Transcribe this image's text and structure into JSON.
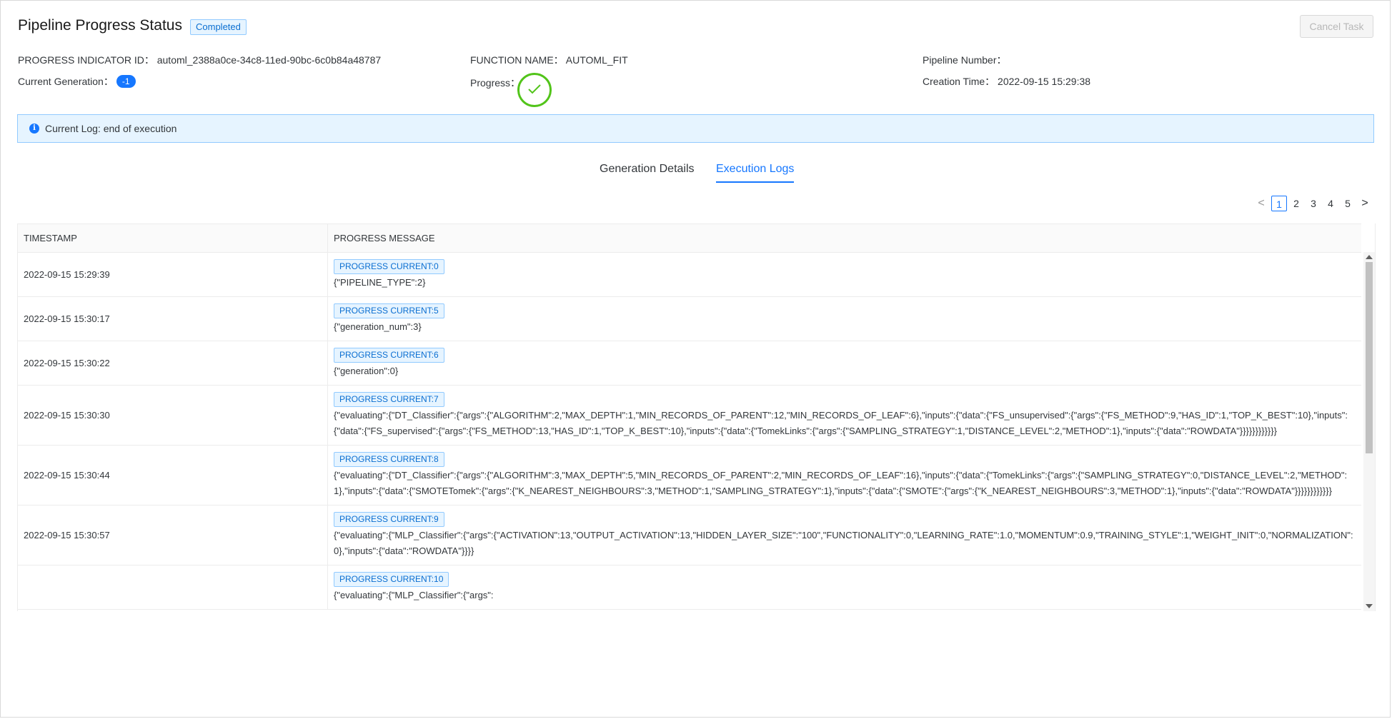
{
  "header": {
    "title": "Pipeline Progress Status",
    "status": "Completed",
    "cancel_label": "Cancel Task"
  },
  "info": {
    "progress_indicator": "PROGRESS INDICATOR ID： automl_2388a0ce-34c8-11ed-90bc-6c0b84a48787",
    "function_name": "FUNCTION NAME： AUTOML_FIT",
    "pipeline_number": "Pipeline Number：",
    "current_generation_label": "Current Generation：",
    "current_generation_value": "-1",
    "progress_label": "Progress：",
    "creation_time": "Creation Time： 2022-09-15 15:29:38"
  },
  "log": {
    "text": "Current Log: end of execution"
  },
  "tabs": [
    {
      "label": "Generation Details",
      "active": false
    },
    {
      "label": "Execution Logs",
      "active": true
    }
  ],
  "pagination": {
    "pages": [
      "1",
      "2",
      "3",
      "4",
      "5"
    ],
    "current": "1",
    "prev": "<",
    "next": ">"
  },
  "table": {
    "columns": [
      "TIMESTAMP",
      "PROGRESS MESSAGE"
    ],
    "rows": [
      {
        "timestamp": "2022-09-15 15:29:39",
        "tag": "PROGRESS CURRENT:0",
        "message": "{\"PIPELINE_TYPE\":2}"
      },
      {
        "timestamp": "2022-09-15 15:30:17",
        "tag": "PROGRESS CURRENT:5",
        "message": "{\"generation_num\":3}"
      },
      {
        "timestamp": "2022-09-15 15:30:22",
        "tag": "PROGRESS CURRENT:6",
        "message": "{\"generation\":0}"
      },
      {
        "timestamp": "2022-09-15 15:30:30",
        "tag": "PROGRESS CURRENT:7",
        "message": "{\"evaluating\":{\"DT_Classifier\":{\"args\":{\"ALGORITHM\":2,\"MAX_DEPTH\":1,\"MIN_RECORDS_OF_PARENT\":12,\"MIN_RECORDS_OF_LEAF\":6},\"inputs\":{\"data\":{\"FS_unsupervised\":{\"args\":{\"FS_METHOD\":9,\"HAS_ID\":1,\"TOP_K_BEST\":10},\"inputs\":{\"data\":{\"FS_supervised\":{\"args\":{\"FS_METHOD\":13,\"HAS_ID\":1,\"TOP_K_BEST\":10},\"inputs\":{\"data\":{\"TomekLinks\":{\"args\":{\"SAMPLING_STRATEGY\":1,\"DISTANCE_LEVEL\":2,\"METHOD\":1},\"inputs\":{\"data\":\"ROWDATA\"}}}}}}}}}}}}"
      },
      {
        "timestamp": "2022-09-15 15:30:44",
        "tag": "PROGRESS CURRENT:8",
        "message": "{\"evaluating\":{\"DT_Classifier\":{\"args\":{\"ALGORITHM\":3,\"MAX_DEPTH\":5,\"MIN_RECORDS_OF_PARENT\":2,\"MIN_RECORDS_OF_LEAF\":16},\"inputs\":{\"data\":{\"TomekLinks\":{\"args\":{\"SAMPLING_STRATEGY\":0,\"DISTANCE_LEVEL\":2,\"METHOD\":1},\"inputs\":{\"data\":{\"SMOTETomek\":{\"args\":{\"K_NEAREST_NEIGHBOURS\":3,\"METHOD\":1,\"SAMPLING_STRATEGY\":1},\"inputs\":{\"data\":{\"SMOTE\":{\"args\":{\"K_NEAREST_NEIGHBOURS\":3,\"METHOD\":1},\"inputs\":{\"data\":\"ROWDATA\"}}}}}}}}}}}}"
      },
      {
        "timestamp": "2022-09-15 15:30:57",
        "tag": "PROGRESS CURRENT:9",
        "message": "{\"evaluating\":{\"MLP_Classifier\":{\"args\":{\"ACTIVATION\":13,\"OUTPUT_ACTIVATION\":13,\"HIDDEN_LAYER_SIZE\":\"100\",\"FUNCTIONALITY\":0,\"LEARNING_RATE\":1.0,\"MOMENTUM\":0.9,\"TRAINING_STYLE\":1,\"WEIGHT_INIT\":0,\"NORMALIZATION\":0},\"inputs\":{\"data\":\"ROWDATA\"}}}}"
      },
      {
        "timestamp": "",
        "tag": "PROGRESS CURRENT:10",
        "message": "{\"evaluating\":{\"MLP_Classifier\":{\"args\":"
      }
    ]
  },
  "colors": {
    "accent": "#1677ff",
    "success": "#52c41a",
    "alert_bg": "#e6f4ff"
  }
}
